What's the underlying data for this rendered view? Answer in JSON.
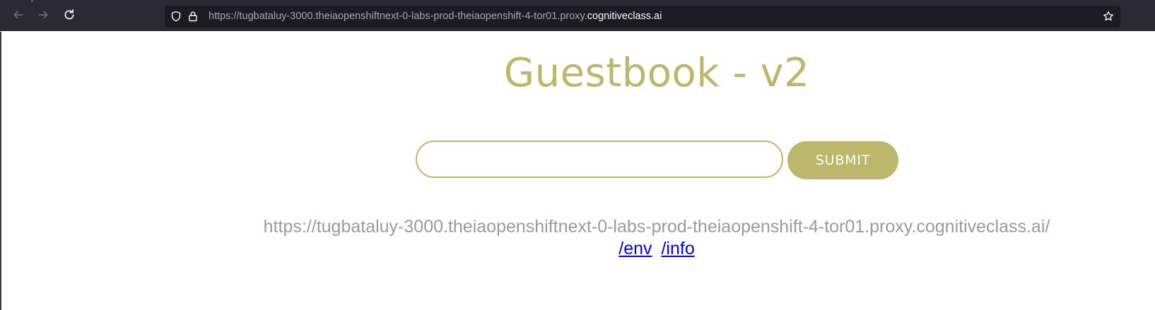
{
  "browser": {
    "url_prefix": "https://tugbataluy-3000.theiaopenshiftnext-0-labs-prod-theiaopenshift-4-tor01.proxy.",
    "url_domain": "cognitiveclass.ai",
    "icons": {
      "back": "arrow-left-icon",
      "forward": "arrow-right-icon",
      "reload": "reload-icon",
      "tracking": "shield-icon",
      "lock": "lock-icon",
      "bookmark": "star-icon"
    }
  },
  "page": {
    "title": "Guestbook - v2",
    "input": {
      "value": "",
      "placeholder": ""
    },
    "submit_label": "SUBMIT",
    "app_url": "https://tugbataluy-3000.theiaopenshiftnext-0-labs-prod-theiaopenshift-4-tor01.proxy.cognitiveclass.ai/",
    "links": [
      {
        "label": "/env"
      },
      {
        "label": "/info"
      }
    ]
  },
  "colors": {
    "accent": "#bdb76b",
    "toolbar_bg": "#2b2a33",
    "urlbar_bg": "#1c1b22",
    "link": "#0000ee",
    "muted_text": "#9b9b9b"
  }
}
